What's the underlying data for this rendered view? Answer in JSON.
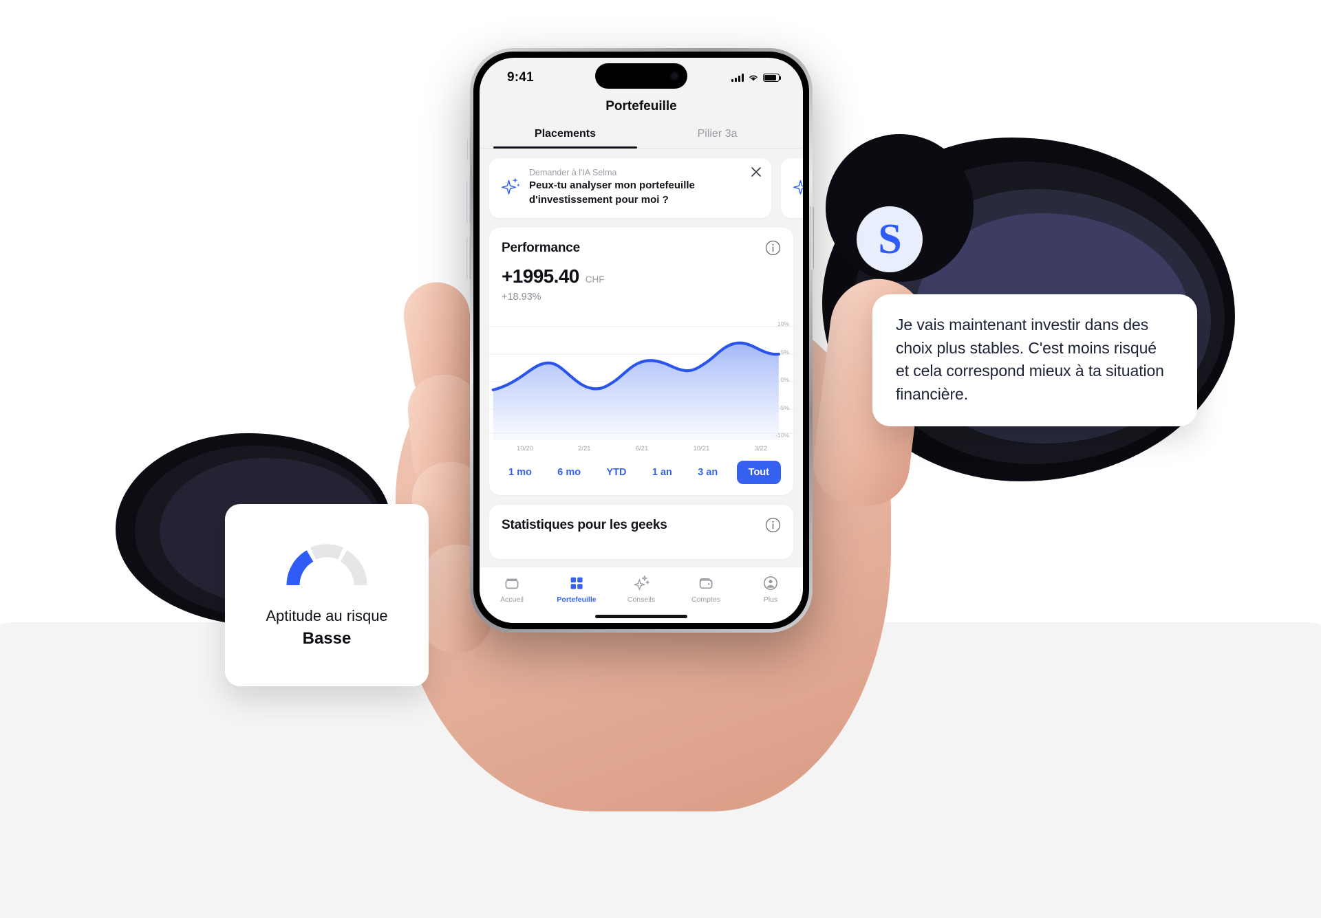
{
  "theme": {
    "accent": "#3661f0",
    "text_dark": "#12121a",
    "text_muted": "#9a9aa2",
    "screen_bg": "#f3f3f3",
    "card_bg": "#ffffff"
  },
  "brand": {
    "logo_letter": "S"
  },
  "status_bar": {
    "time": "9:41",
    "signal_icon": "cellular-bars-icon",
    "wifi_icon": "wifi-icon",
    "battery_icon": "battery-icon"
  },
  "nav": {
    "title": "Portefeuille"
  },
  "tabs": [
    {
      "label": "Placements",
      "active": true
    },
    {
      "label": "Pilier 3a",
      "active": false
    }
  ],
  "ai_prompt": {
    "kicker": "Demander à l'IA Selma",
    "question": "Peux-tu analyser mon portefeuille d'investissement pour moi ?",
    "sparkle_icon": "sparkle-icon",
    "close_icon": "close-icon"
  },
  "performance": {
    "title": "Performance",
    "info_icon": "info-icon",
    "value": "+1995.40",
    "currency": "CHF",
    "percent": "+18.93%",
    "ranges": [
      {
        "label": "1 mo",
        "active": false,
        "clipped": true
      },
      {
        "label": "6 mo",
        "active": false
      },
      {
        "label": "YTD",
        "active": false
      },
      {
        "label": "1 an",
        "active": false
      },
      {
        "label": "3 an",
        "active": false
      },
      {
        "label": "Tout",
        "active": true
      }
    ]
  },
  "geek_stats": {
    "title": "Statistiques pour les geeks",
    "info_icon": "info-icon"
  },
  "bottom_nav": [
    {
      "label": "Accueil",
      "icon": "home-box-icon",
      "active": false
    },
    {
      "label": "Portefeuille",
      "icon": "grid-squares-icon",
      "active": true
    },
    {
      "label": "Conseils",
      "icon": "sparkle-icon",
      "active": false
    },
    {
      "label": "Comptes",
      "icon": "wallet-icon",
      "active": false
    },
    {
      "label": "Plus",
      "icon": "person-circle-icon",
      "active": false
    }
  ],
  "risk_card": {
    "label": "Aptitude au risque",
    "value": "Basse",
    "gauge_icon": "gauge-icon",
    "gauge_filled_segments": 1,
    "gauge_total_segments": 3
  },
  "speech_bubble": {
    "text": "Je vais maintenant investir dans des choix plus stables. C'est moins risqué et cela correspond mieux à ta situation financière."
  },
  "chart_data": {
    "type": "area",
    "title": "Performance",
    "xlabel": "",
    "ylabel": "",
    "ylim": [
      -10,
      10
    ],
    "grid": true,
    "legend": null,
    "line_color": "#2b54ea",
    "fill_color": "#c3d0fa",
    "y_ticks": [
      "10%",
      "5%",
      "0%",
      "-5%",
      "-10%"
    ],
    "y_tick_values": [
      10,
      5,
      0,
      -5,
      -10
    ],
    "x_ticks": [
      "10/20",
      "2/21",
      "6/21",
      "10/21",
      "3/22"
    ],
    "x": [
      0,
      4,
      8,
      12,
      16,
      20,
      24,
      28,
      32,
      36,
      40,
      44,
      48,
      52,
      56,
      60,
      64,
      68,
      72,
      76,
      80,
      84,
      88,
      92,
      96,
      100
    ],
    "values": [
      -1.2,
      -0.4,
      0.6,
      1.6,
      2.4,
      2.8,
      2.4,
      1.5,
      0.4,
      -0.4,
      -0.7,
      -0.3,
      0.7,
      2.0,
      3.2,
      4.1,
      4.3,
      3.9,
      3.3,
      3.1,
      3.4,
      4.4,
      5.6,
      6.6,
      7.1,
      6.7
    ]
  }
}
